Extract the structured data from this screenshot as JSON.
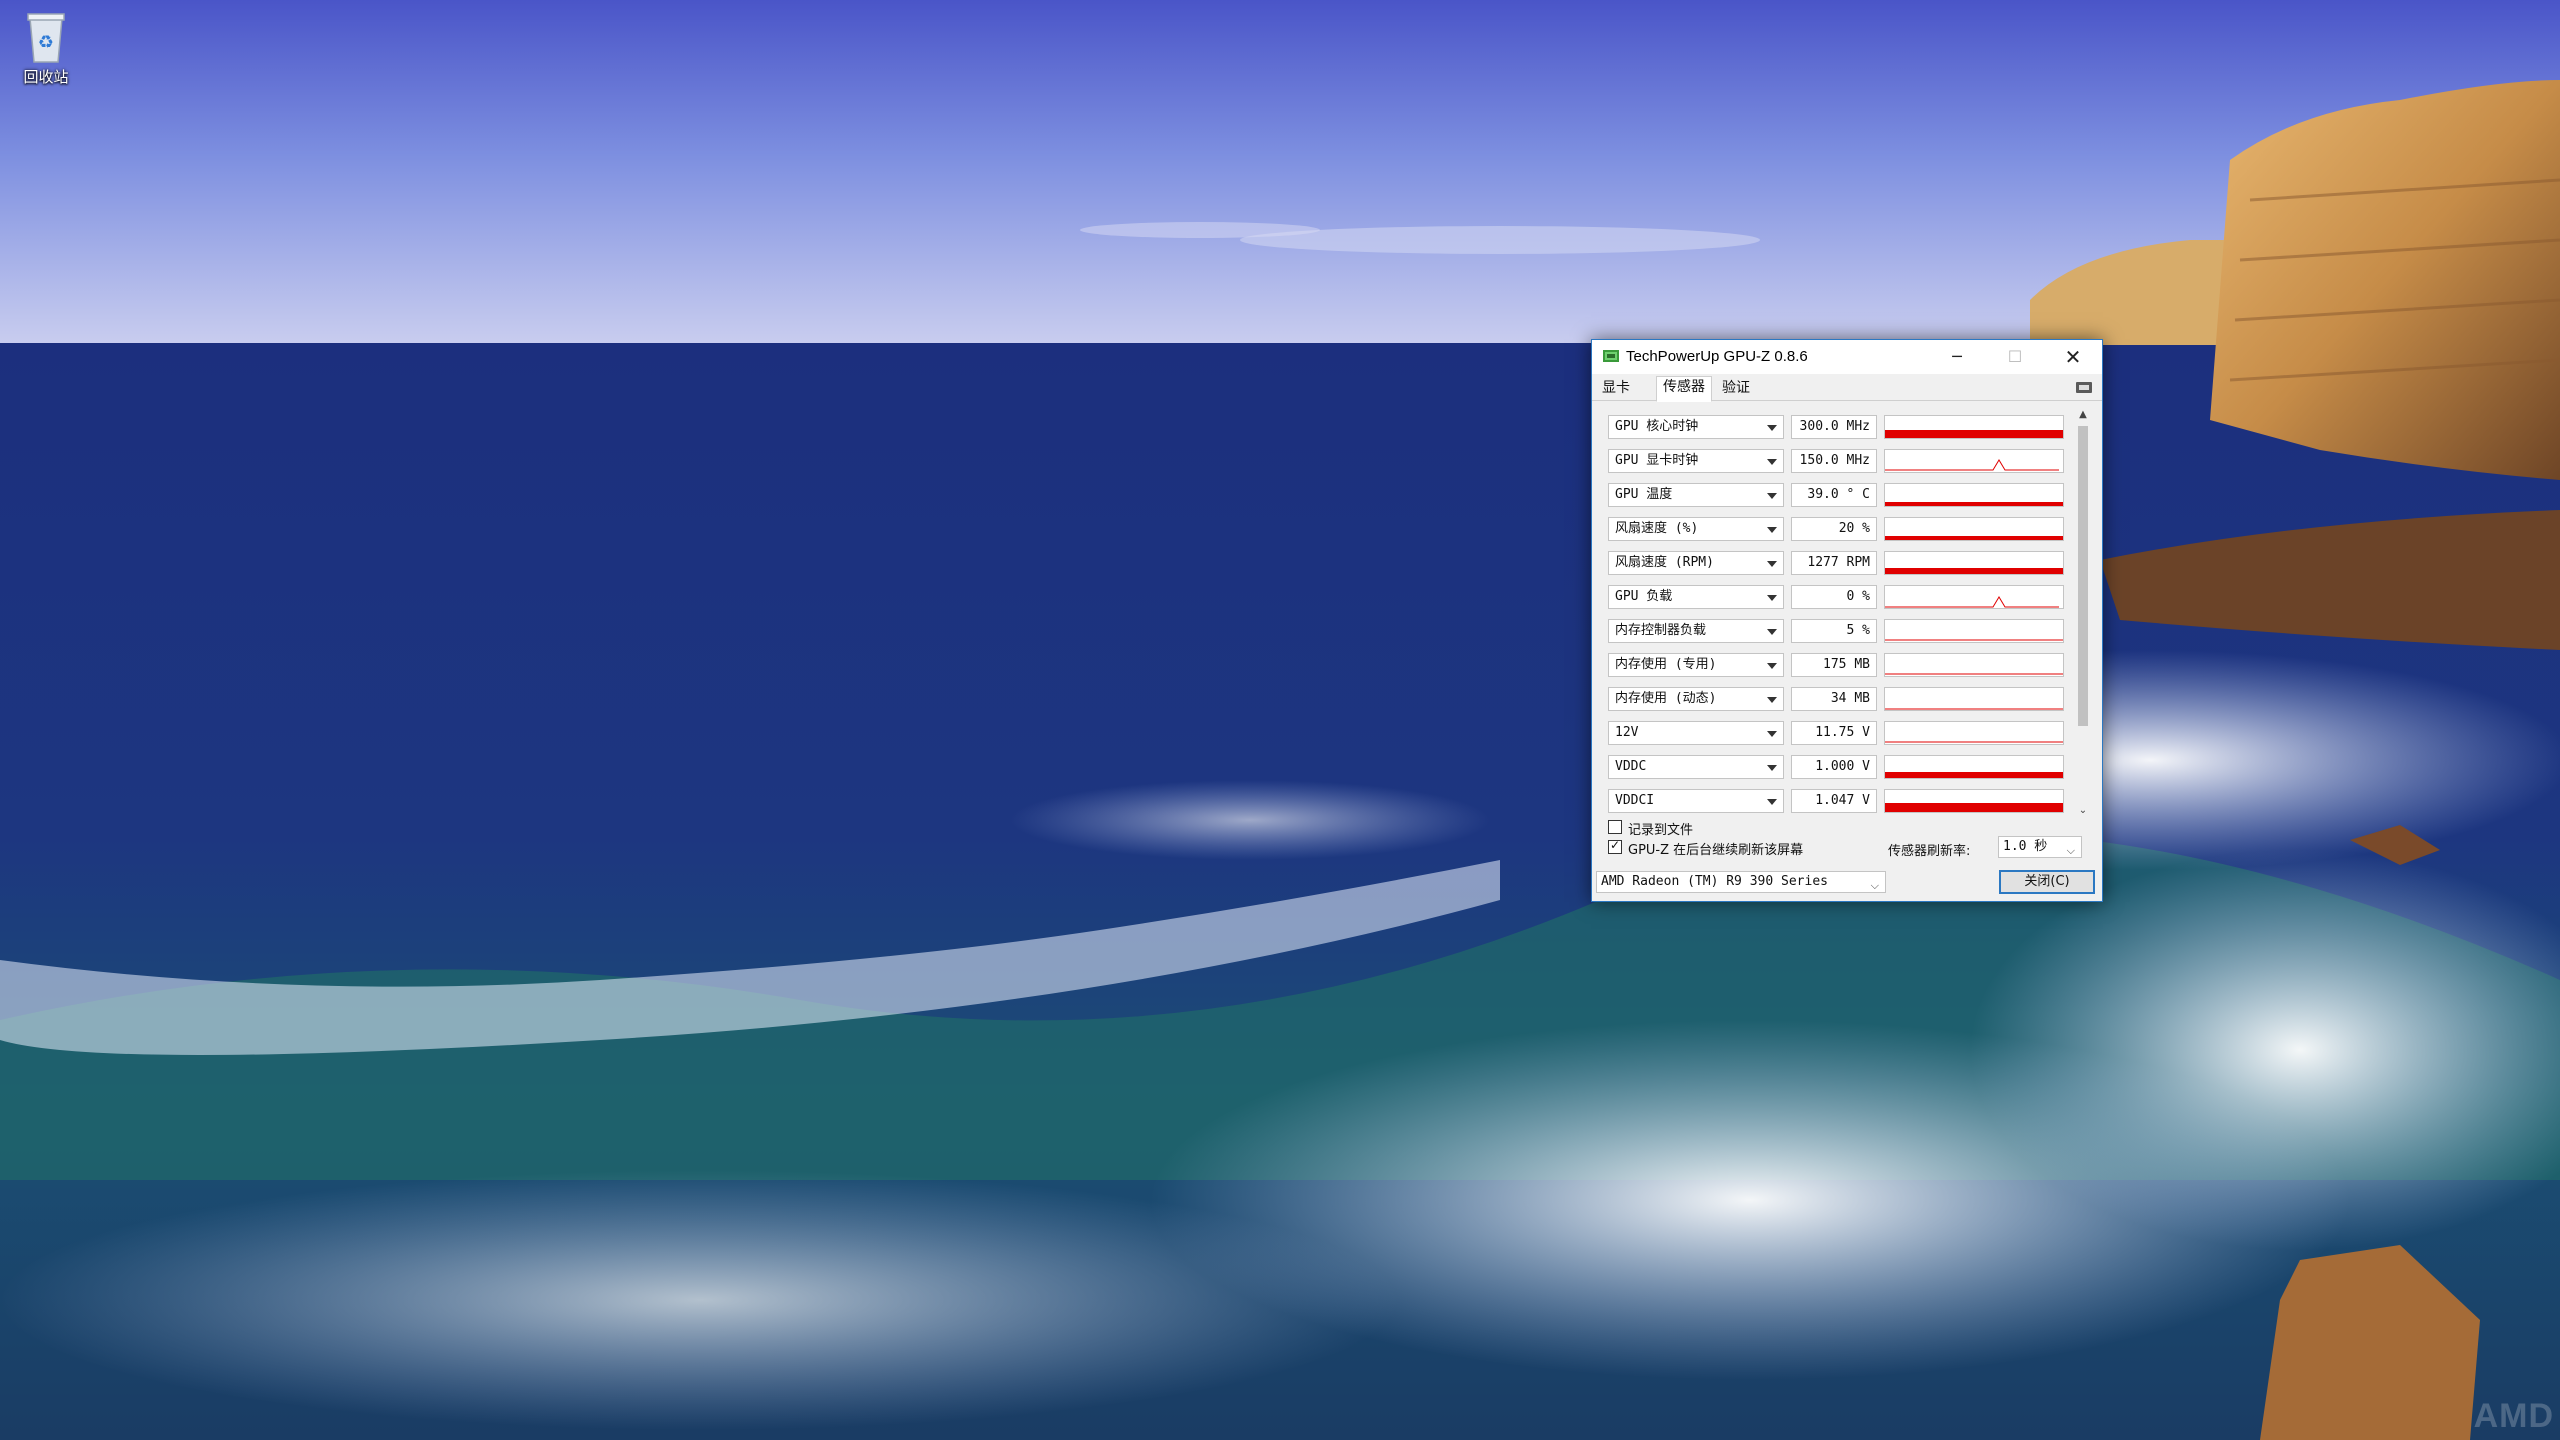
{
  "desktop": {
    "recycle_bin_label": "回收站",
    "watermark": "AMD"
  },
  "window": {
    "title": "TechPowerUp GPU-Z 0.8.6",
    "tabs": [
      {
        "label": "显卡",
        "active": false
      },
      {
        "label": "传感器",
        "active": true
      },
      {
        "label": "验证",
        "active": false
      }
    ],
    "sensors": [
      {
        "name": "GPU 核心时钟",
        "value": "300.0 MHz",
        "graph_fill": 0.35,
        "graph_style": "bar"
      },
      {
        "name": "GPU 显卡时钟",
        "value": "150.0 MHz",
        "graph_fill": 0.05,
        "graph_style": "spike"
      },
      {
        "name": "GPU 温度",
        "value": "39.0 ° C",
        "graph_fill": 0.18,
        "graph_style": "bar"
      },
      {
        "name": "风扇速度 (%)",
        "value": "20 %",
        "graph_fill": 0.18,
        "graph_style": "bar"
      },
      {
        "name": "风扇速度 (RPM)",
        "value": "1277 RPM",
        "graph_fill": 0.28,
        "graph_style": "bar"
      },
      {
        "name": "GPU 负载",
        "value": "0 %",
        "graph_fill": 0.0,
        "graph_style": "spike"
      },
      {
        "name": "内存控制器负载",
        "value": "5 %",
        "graph_fill": 0.05,
        "graph_style": "line"
      },
      {
        "name": "内存使用 (专用)",
        "value": "175 MB",
        "graph_fill": 0.04,
        "graph_style": "line"
      },
      {
        "name": "内存使用 (动态)",
        "value": "34 MB",
        "graph_fill": 0.0,
        "graph_style": "line"
      },
      {
        "name": "12V",
        "value": "11.75 V",
        "graph_fill": 0.04,
        "graph_style": "line"
      },
      {
        "name": "VDDC",
        "value": "1.000 V",
        "graph_fill": 0.28,
        "graph_style": "bar"
      },
      {
        "name": "VDDCI",
        "value": "1.047 V",
        "graph_fill": 0.42,
        "graph_style": "bar"
      }
    ],
    "log_to_file_label": "记录到文件",
    "log_to_file_checked": false,
    "continue_refresh_label": "GPU-Z 在后台继续刷新该屏幕",
    "continue_refresh_checked": true,
    "refresh_rate_label": "传感器刷新率:",
    "refresh_rate_value": "1.0 秒",
    "card_select_value": "AMD Radeon (TM) R9 390 Series",
    "close_button_label": "关闭(C)",
    "graph_color": "#e00000"
  }
}
